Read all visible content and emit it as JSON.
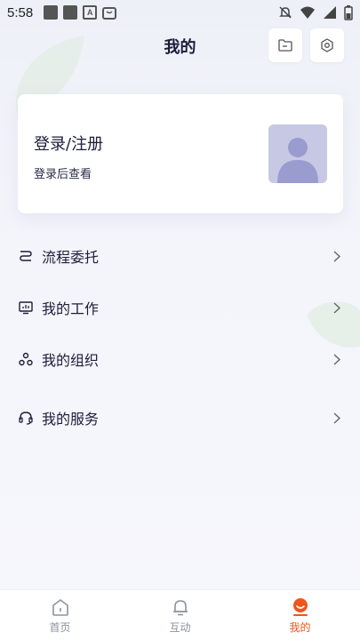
{
  "status_bar": {
    "time": "5:58"
  },
  "header": {
    "title": "我的"
  },
  "login_card": {
    "title": "登录/注册",
    "subtitle": "登录后查看"
  },
  "menu": {
    "items": [
      {
        "label": "流程委托",
        "icon": "flow-icon"
      },
      {
        "label": "我的工作",
        "icon": "monitor-icon"
      },
      {
        "label": "我的组织",
        "icon": "organization-icon"
      },
      {
        "label": "我的服务",
        "icon": "headset-icon"
      }
    ]
  },
  "tabbar": {
    "tabs": [
      {
        "label": "首页",
        "icon": "home-icon",
        "active": false
      },
      {
        "label": "互动",
        "icon": "bell-icon",
        "active": false
      },
      {
        "label": "我的",
        "icon": "profile-icon",
        "active": true
      }
    ]
  },
  "colors": {
    "accent": "#f0551b",
    "text": "#1c1d3a",
    "avatar_bg": "#c7c8e4",
    "avatar_fg": "#9a9ccf"
  }
}
